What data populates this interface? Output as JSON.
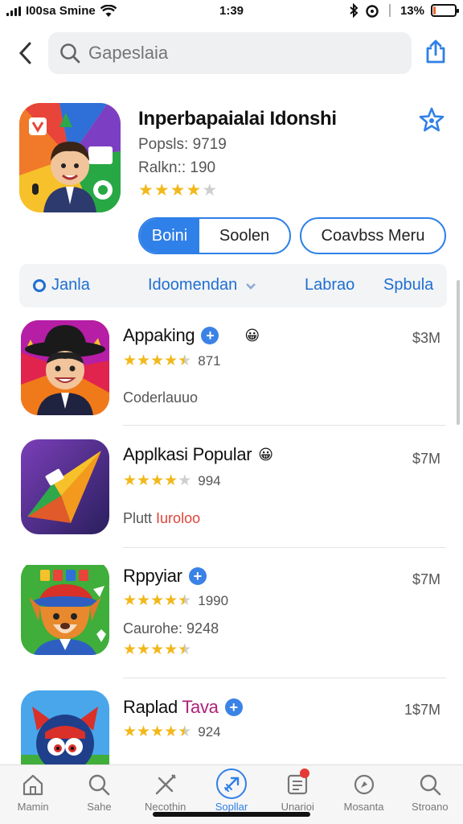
{
  "status_bar": {
    "carrier": "I00sa Smine",
    "time": "1:39",
    "battery": "13%",
    "battery_level": 0.13
  },
  "search": {
    "placeholder": "Gapeslaia"
  },
  "featured": {
    "title": "Inperbapaialai Idonshi",
    "popularity": "Popsls: 9719",
    "rank": "Ralkn:: 190",
    "rating": 4,
    "rating_max": 5,
    "segment": {
      "selected": "Boini",
      "other": "Soolen"
    },
    "button": "Coavbss Meru"
  },
  "filter": {
    "items": [
      {
        "label": "Janla"
      },
      {
        "label": "Idoomendan"
      },
      {
        "label": "Labrao"
      },
      {
        "label": "Spbula"
      }
    ]
  },
  "apps": [
    {
      "name": "Appaking",
      "rating": 4.5,
      "count": "871",
      "subtitle": "Coderlauuo",
      "price": "$3M",
      "verified": true,
      "emoji": "😀"
    },
    {
      "name": "Applkasi Popular",
      "rating": 4,
      "count": "994",
      "subtitle_a": "Plutt",
      "subtitle_b": "Iuroloo",
      "price": "$7M",
      "emoji": "😀"
    },
    {
      "name": "Rppyiar",
      "rating": 4.5,
      "count": "1990",
      "subtitle": "Caurohe: 9248",
      "rating2": 4.5,
      "price": "$7M",
      "verified": true
    },
    {
      "name_a": "Raplad",
      "name_b": "Tava",
      "rating": 4.5,
      "count": "924",
      "price": "1$7M",
      "verified": true
    }
  ],
  "tabbar": {
    "tabs": [
      {
        "label": "Mamin"
      },
      {
        "label": "Sahe"
      },
      {
        "label": "Necothin"
      },
      {
        "label": "Sopllar",
        "active": true
      },
      {
        "label": "Unarioi"
      },
      {
        "label": "Mosanta"
      },
      {
        "label": "Stroano"
      }
    ]
  },
  "colors": {
    "accent": "#2f80e8",
    "star": "#f2b81a",
    "battery": "#f0642c"
  }
}
